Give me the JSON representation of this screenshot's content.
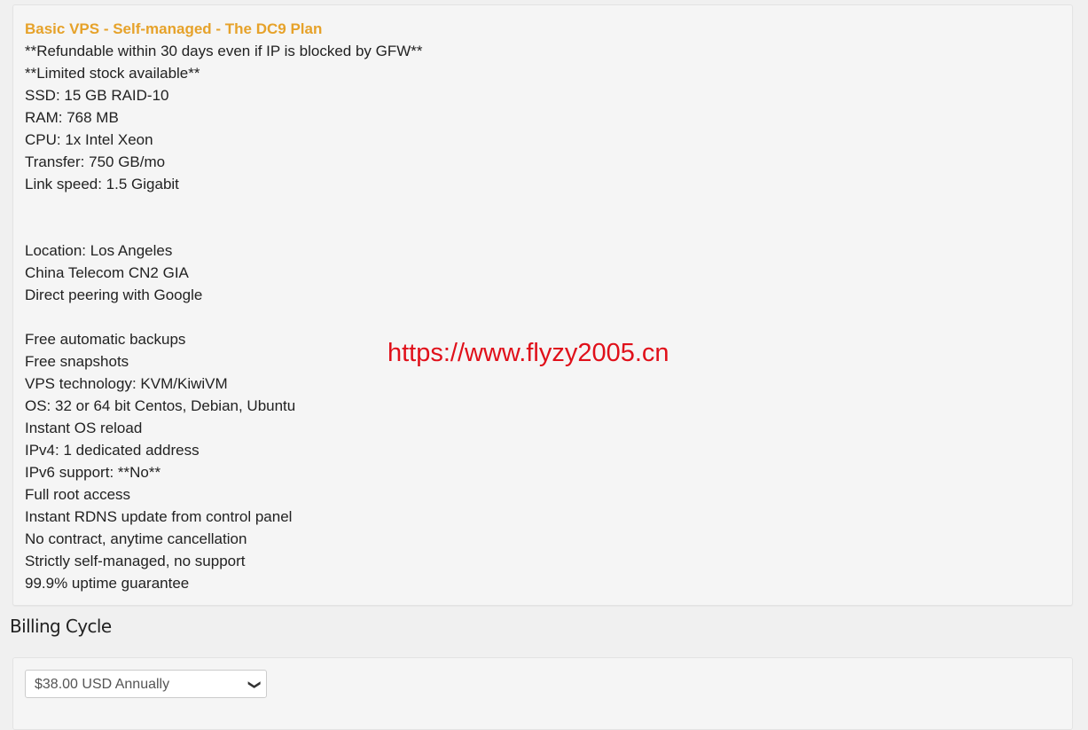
{
  "plan": {
    "title": "Basic VPS - Self-managed - The DC9 Plan",
    "lines": [
      "**Refundable within 30 days even if IP is blocked by GFW**",
      "**Limited stock available**",
      "SSD: 15 GB RAID-10",
      "RAM: 768 MB",
      "CPU: 1x Intel Xeon",
      "Transfer: 750 GB/mo",
      "Link speed: 1.5 Gigabit",
      "",
      "",
      "Location: Los Angeles",
      "China Telecom CN2 GIA",
      "Direct peering with Google",
      "",
      "Free automatic backups",
      "Free snapshots",
      "VPS technology: KVM/KiwiVM",
      "OS: 32 or 64 bit Centos, Debian, Ubuntu",
      "Instant OS reload",
      "IPv4: 1 dedicated address",
      "IPv6 support: **No**",
      "Full root access",
      "Instant RDNS update from control panel",
      "No contract, anytime cancellation",
      "Strictly self-managed, no support",
      "99.9% uptime guarantee"
    ]
  },
  "watermark": "https://www.flyzy2005.cn",
  "billing": {
    "title": "Billing Cycle",
    "selected": "$38.00 USD Annually",
    "icon": "chevron-down-icon"
  },
  "colors": {
    "title": "#e6a22a",
    "watermark": "#e0101a"
  }
}
